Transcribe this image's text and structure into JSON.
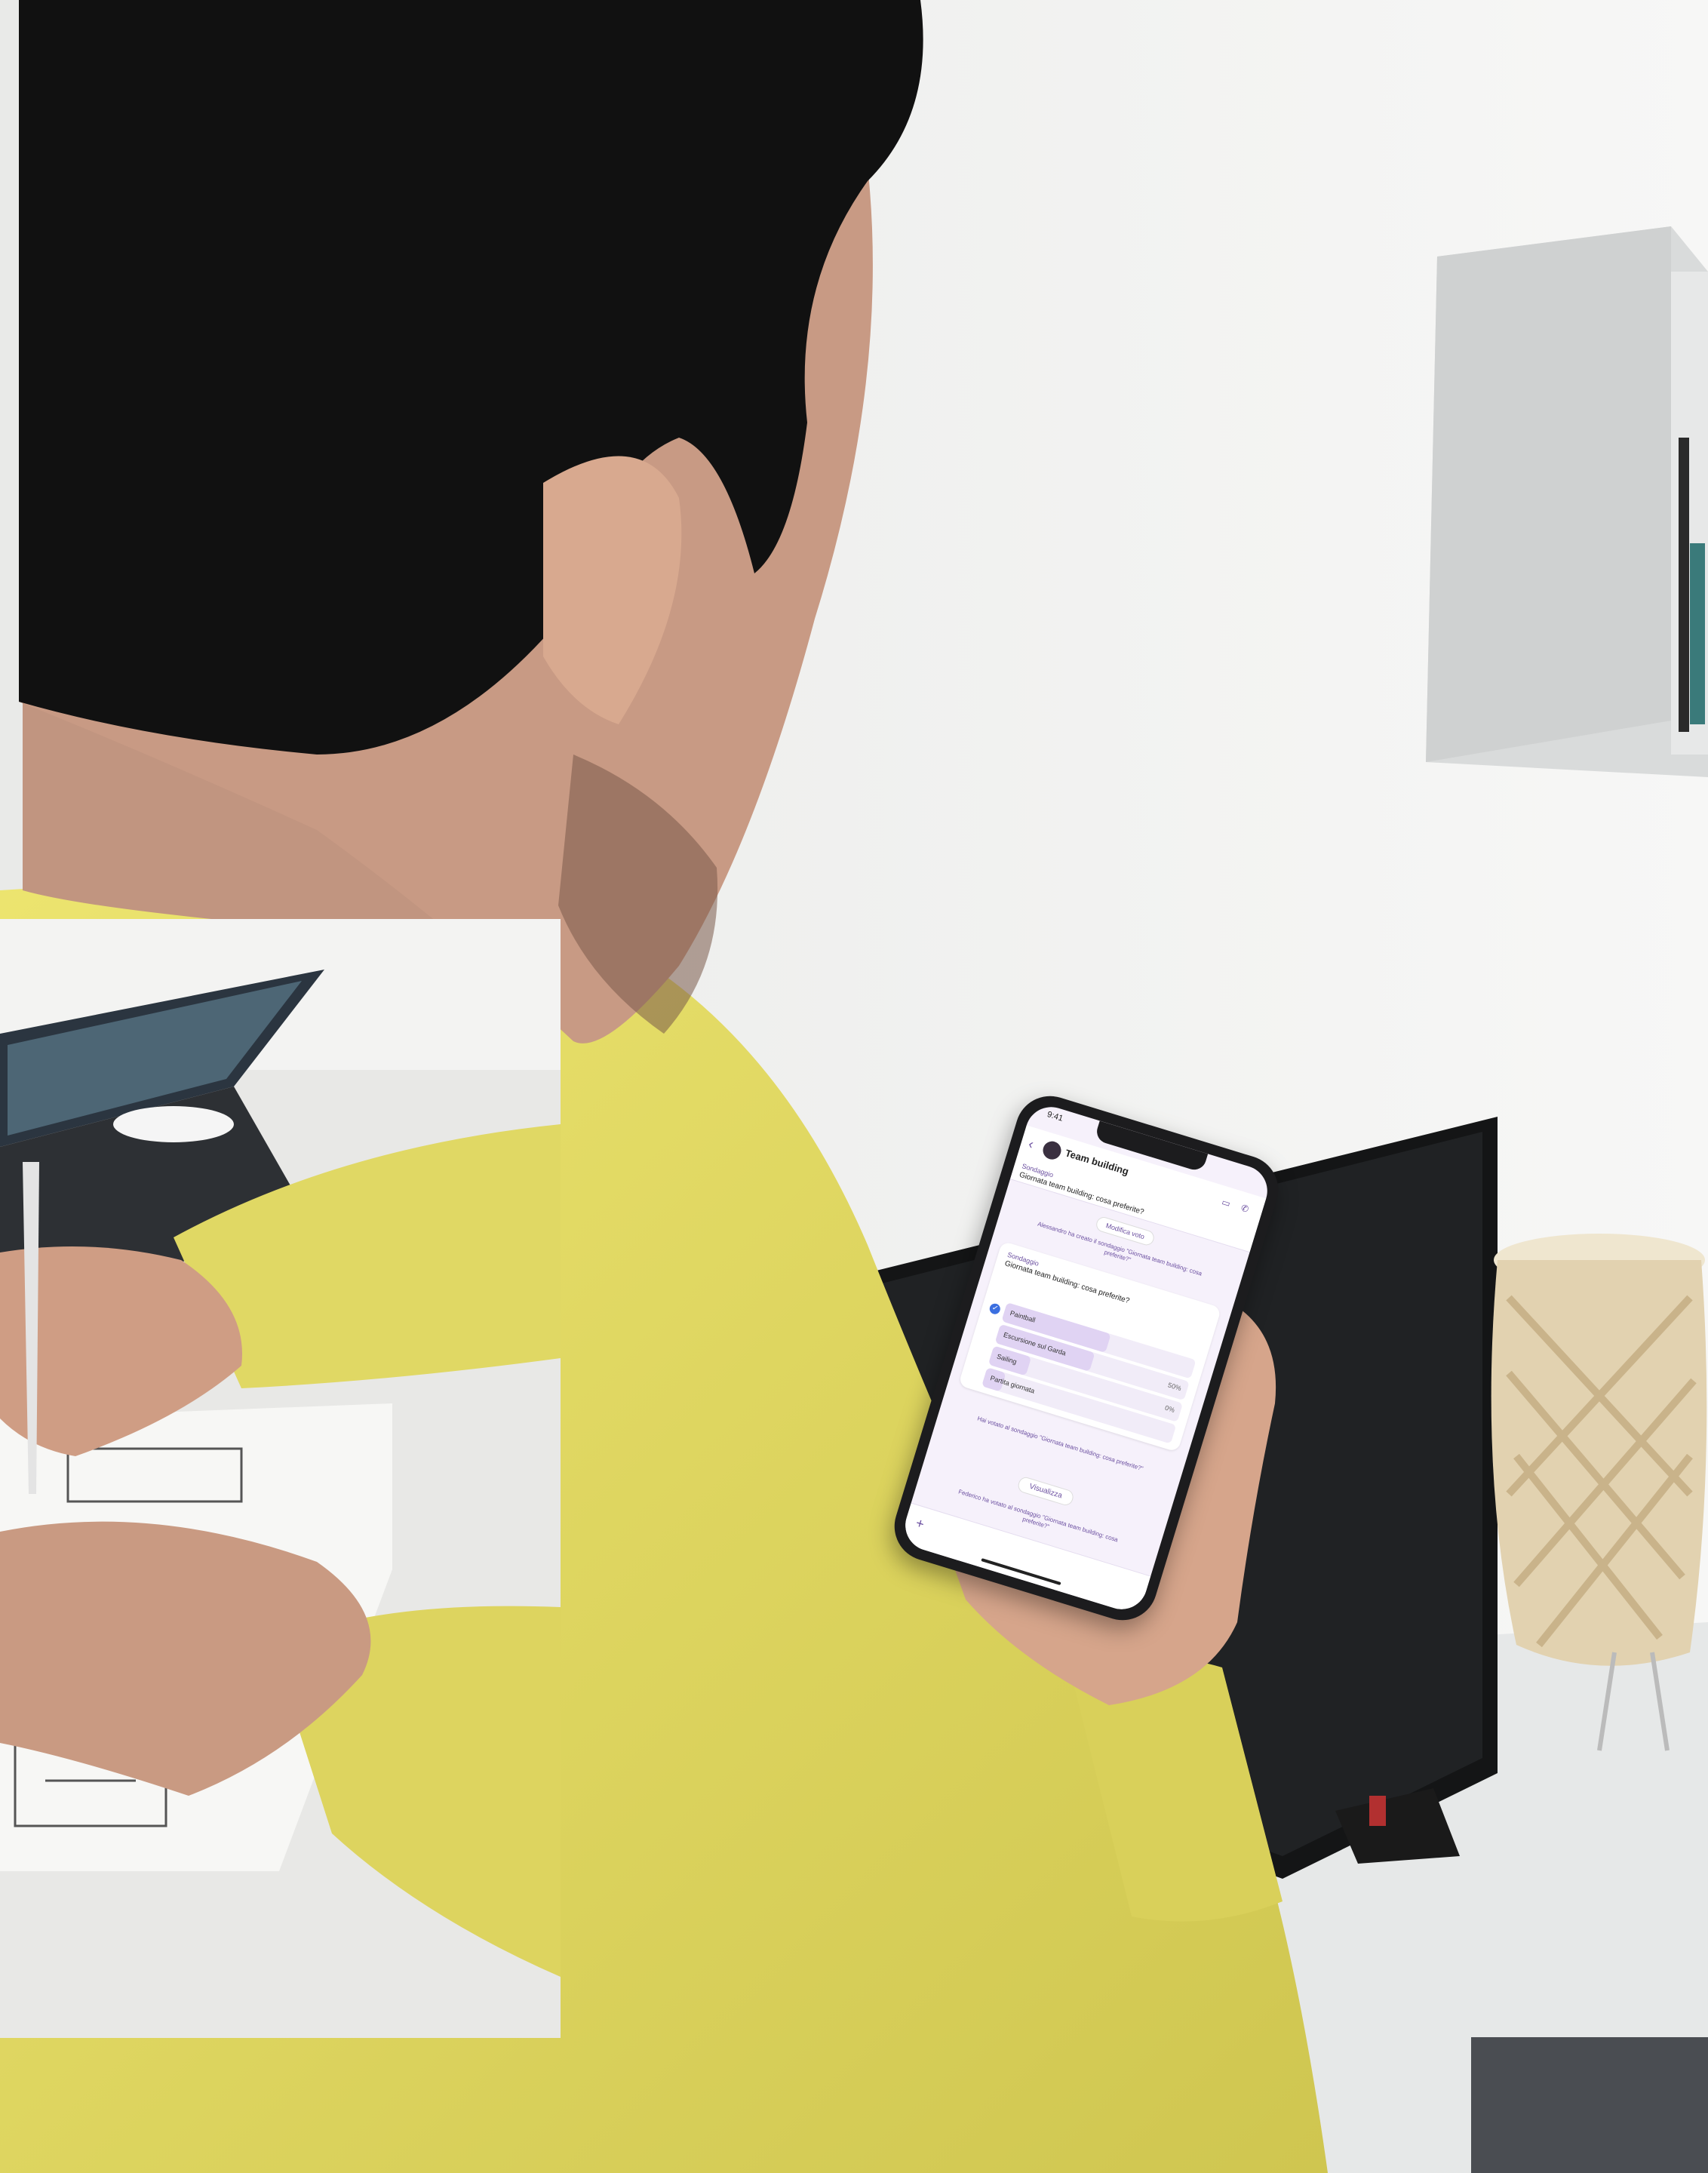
{
  "scene": {
    "palette": {
      "wall": "#f2f3f1",
      "sweater": "#e3dc6a",
      "hair": "#111111",
      "skin": "#c89a84",
      "desk": "#e4e6e6",
      "tv": "#161718",
      "lamp": "#e0cfae",
      "shelf": "#dadcdc",
      "paper": "#f7f7f5"
    },
    "elements": [
      "person-head",
      "yellow-sweater",
      "smartphone",
      "tv-monitor",
      "woven-lamp",
      "wall-shelf",
      "inset-photo-sketching"
    ]
  },
  "phone_ui": {
    "status_time": "9:41",
    "group_name": "Team building",
    "group_sub": "",
    "poll_banner_label": "Sondaggio",
    "poll_banner_question": "Giornata team building: cosa preferite?",
    "edit_label": "Modifica voto",
    "system_message_1": "Alessandro ha creato il sondaggio \"Giornata team building: cosa preferite?\"",
    "poll_kicker": "Sondaggio",
    "poll_question": "Giornata team building: cosa preferite?",
    "options": [
      {
        "label": "Paintball",
        "pct": "",
        "fill": 0.55
      },
      {
        "label": "Escursione sul Garda",
        "pct": "50%",
        "fill": 0.5
      },
      {
        "label": "Sailing",
        "pct": "0%",
        "fill": 0.2
      },
      {
        "label": "Partita giornata",
        "pct": "",
        "fill": 0.1
      }
    ],
    "poll_meta": "",
    "system_message_2": "Hai votato al sondaggio \"Giornata team building: cosa preferite?\"",
    "vote_label": "Visualizza",
    "system_message_3": "Federico ha votato al sondaggio \"Giornata team building: cosa preferite?\""
  }
}
